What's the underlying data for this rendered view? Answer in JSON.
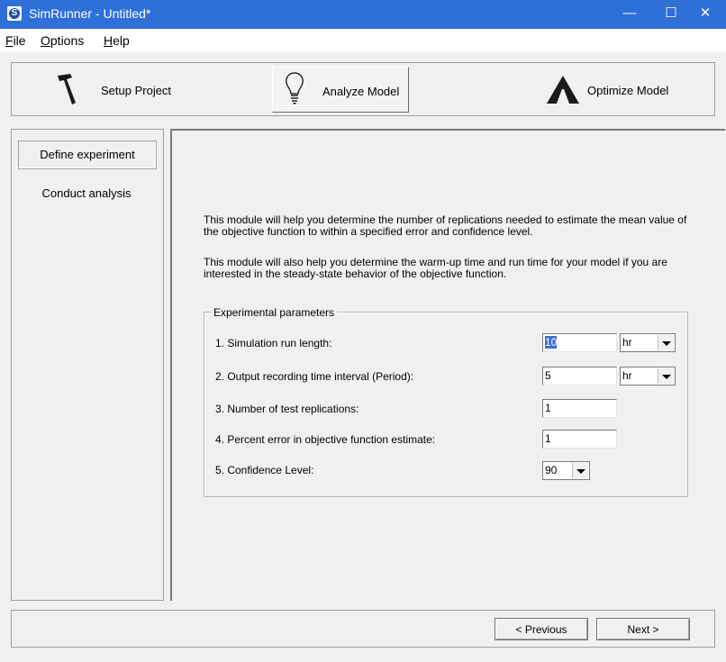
{
  "window": {
    "title": "SimRunner - Untitled*",
    "app_icon_letter": "S",
    "minimize_glyph": "—",
    "maximize_glyph": "☐",
    "close_glyph": "✕"
  },
  "menu": {
    "items": [
      {
        "label": "File",
        "mnemonic": "F"
      },
      {
        "label": "Options",
        "mnemonic": "O"
      },
      {
        "label": "Help",
        "mnemonic": "H"
      }
    ]
  },
  "modes": [
    {
      "label": "Setup Project",
      "icon": "hammer-icon"
    },
    {
      "label": "Analyze Model",
      "icon": "lightbulb-icon",
      "active": true
    },
    {
      "label": "Optimize Model",
      "icon": "mountain-icon"
    }
  ],
  "nav": {
    "items": [
      {
        "label": "Define experiment",
        "selected": true
      },
      {
        "label": "Conduct analysis",
        "selected": false
      }
    ]
  },
  "main": {
    "paragraph1": "This module will help you determine the number of replications needed to estimate the mean value of the objective function to within a specified error and confidence level.",
    "paragraph2": "This module will also help you determine the warm-up time and run time for your model if you are interested in the steady-state behavior of the objective function.",
    "group_title": "Experimental parameters",
    "params": [
      {
        "label": "1. Simulation run length:",
        "value": "10",
        "unit": "hr"
      },
      {
        "label": "2. Output recording time interval (Period):",
        "value": "5",
        "unit": "hr"
      },
      {
        "label": "3. Number of test replications:",
        "value": "1"
      },
      {
        "label": "4. Percent error in objective function estimate:",
        "value": "1"
      },
      {
        "label": "5. Confidence Level:",
        "value": "90"
      }
    ]
  },
  "footer": {
    "previous_label": "< Previous",
    "next_label": "Next >"
  },
  "colors": {
    "titlebar": "#2f6fd8",
    "selection": "#3a6fd8"
  }
}
